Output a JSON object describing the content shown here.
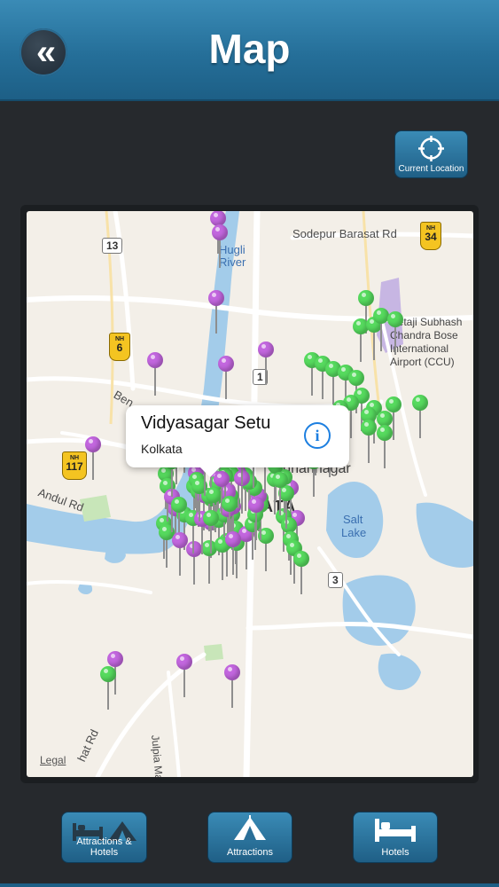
{
  "header": {
    "title": "Map",
    "back_icon": "double-chevron-left-icon"
  },
  "current_location": {
    "label": "Current Location",
    "icon": "crosshair-icon"
  },
  "map": {
    "labels": {
      "sodepur": "Sodepur Barasat Rd",
      "hugli": "Hugli",
      "river": "River",
      "netaji1": "Netaji Subhash",
      "netaji2": "Chandra Bose",
      "netaji3": "International",
      "netaji4": "Airport (CCU)",
      "salt": "Salt",
      "lake": "Lake",
      "andul": "Andul Rd",
      "kolkata": "KATA",
      "bidhan": "Bidhannagar",
      "beng": "Ben",
      "julpia": "Julpia Ma",
      "hat": "hat Rd",
      "legal": "Legal"
    },
    "shields": {
      "r13": "13",
      "r1": "1",
      "r3": "3"
    },
    "highways": {
      "prefix": "NH",
      "nh6": "6",
      "nh34": "34",
      "nh117": "117"
    },
    "callout": {
      "title": "Vidyasagar Setu",
      "subtitle": "Kolkata",
      "icon": "info-icon"
    },
    "pin_colors": {
      "attraction": "#56da5e",
      "hotel": "#c266de"
    }
  },
  "tabs": {
    "all": {
      "label": "Attractions & Hotels",
      "icon": "bed-and-tent-icon"
    },
    "attractions": {
      "label": "Attractions",
      "icon": "tent-icon"
    },
    "hotels": {
      "label": "Hotels",
      "icon": "bed-icon"
    }
  }
}
